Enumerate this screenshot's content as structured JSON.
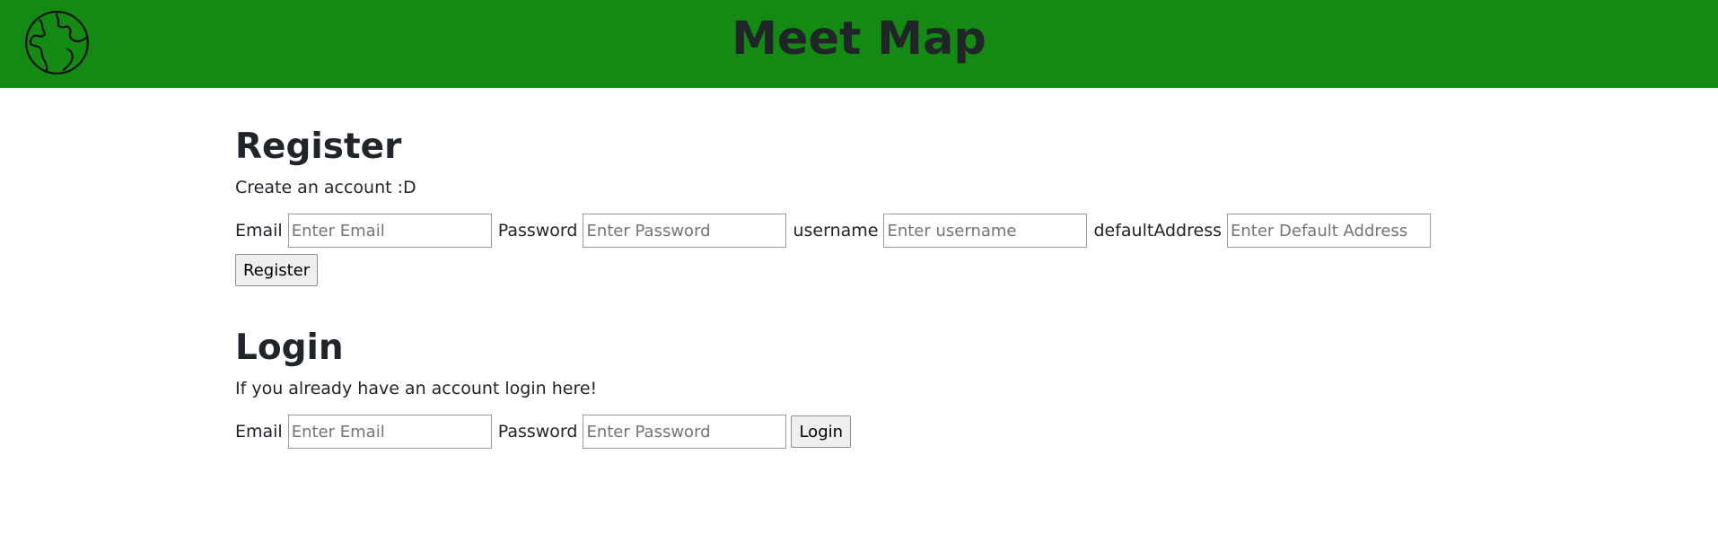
{
  "colors": {
    "brand": "#138a12",
    "text": "#212529"
  },
  "header": {
    "logo_icon": "globe-icon",
    "title": "Meet Map"
  },
  "register": {
    "heading": "Register",
    "subtitle": "Create an account :D",
    "email_label": "Email",
    "email_placeholder": "Enter Email",
    "email_value": "",
    "password_label": "Password",
    "password_placeholder": "Enter Password",
    "password_value": "",
    "username_label": "username",
    "username_placeholder": "Enter username",
    "username_value": "",
    "address_label": "defaultAddress",
    "address_placeholder": "Enter Default Address",
    "address_value": "",
    "button_label": "Register"
  },
  "login": {
    "heading": "Login",
    "subtitle": "If you already have an account login here!",
    "email_label": "Email",
    "email_placeholder": "Enter Email",
    "email_value": "",
    "password_label": "Password",
    "password_placeholder": "Enter Password",
    "password_value": "",
    "button_label": "Login"
  }
}
